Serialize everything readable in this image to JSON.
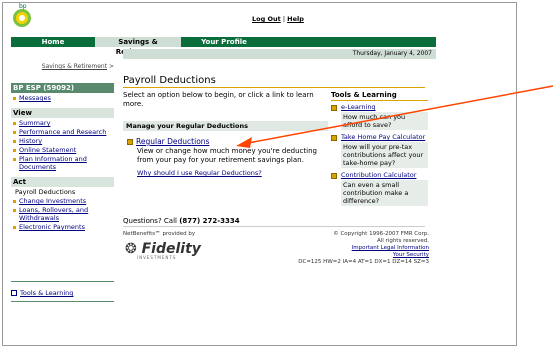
{
  "logo": {
    "text": "bp"
  },
  "toplinks": {
    "logout": "Log Out",
    "sep": " | ",
    "help": "Help"
  },
  "nav": {
    "home": "Home",
    "savings": "Savings & Retirement",
    "profile": "Your Profile"
  },
  "date": "Thursday, January 4, 2007",
  "crumb": {
    "label": "Savings & Retirement",
    "sep": " >"
  },
  "sidebar": {
    "plan": "BP ESP (59092)",
    "messages": "Messages",
    "view_hdr": "View",
    "view_items": [
      "Summary",
      "Performance and Research",
      "History",
      "Online Statement",
      "Plan Information and Documents"
    ],
    "act_hdr": "Act",
    "act_current": "Payroll Deductions",
    "act_items": [
      "Change Investments",
      "Loans, Rollovers, and Withdrawals",
      "Electronic Payments"
    ],
    "tools": "Tools & Learning"
  },
  "main": {
    "title": "Payroll Deductions",
    "intro": "Select an option below to begin, or click a link to learn more.",
    "manage_hdr": "Manage your Regular Deductions",
    "reg_link": "Regular Deductions",
    "reg_desc": "View or change how much money you're deducting from your pay for your retirement savings plan.",
    "why_link": "Why should I use Regular Deductions?"
  },
  "tools": {
    "title": "Tools & Learning",
    "items": [
      {
        "link": "e-Learning",
        "q": "How much can you afford to save?"
      },
      {
        "link": "Take Home Pay Calculator",
        "q": "How will your pre-tax contributions affect your take-home pay?"
      },
      {
        "link": "Contribution Calculator",
        "q": "Can even a small contribution make a difference?"
      }
    ]
  },
  "footer": {
    "questions_prefix": "Questions? Call ",
    "phone": "(877) 272-3334",
    "netbenefits": "NetBenefits℠ provided by",
    "fidelity": "Fidelity",
    "fidelity_sub": "INVESTMENTS",
    "copyright": "© Copyright 1996-2007 FMR Corp.",
    "rights": "All rights reserved.",
    "legal": "Important Legal Information",
    "security": "Your Security",
    "dc": "DC=125 HW=2 IA=4 AT=1 DX=1 DZ=14 SZ=3"
  },
  "colors": {
    "nav_green": "#0a6d3c",
    "accent_gold": "#d9a400",
    "arrow": "#ff4500"
  }
}
